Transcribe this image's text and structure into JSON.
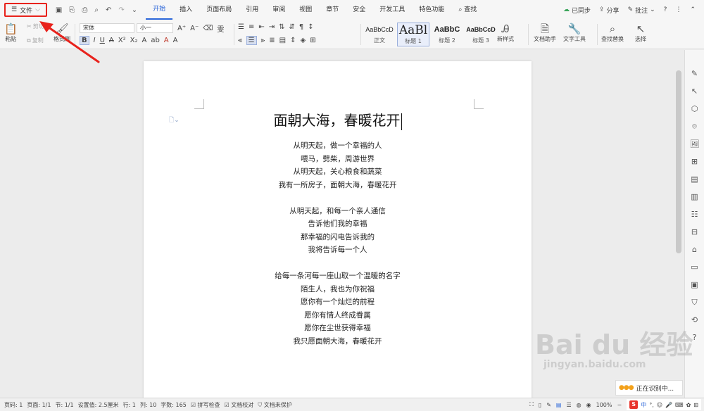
{
  "menubar": {
    "file_label": "文件",
    "tabs": [
      "开始",
      "插入",
      "页面布局",
      "引用",
      "审阅",
      "视图",
      "章节",
      "安全",
      "开发工具",
      "特色功能"
    ],
    "search_label": "查找",
    "sync_label": "已同步",
    "share_label": "分享",
    "comment_label": "批注",
    "help_label": "?"
  },
  "ribbon": {
    "paste_label": "粘贴",
    "cut_label": "剪切",
    "copy_label": "复制",
    "format_painter_label": "格式刷",
    "font_name": "宋体",
    "font_size": "小一",
    "styles": [
      {
        "sample": "AaBbCcD",
        "name": "正文"
      },
      {
        "sample": "AaBl",
        "name": "标题 1"
      },
      {
        "sample": "AaBbC",
        "name": "标题 2"
      },
      {
        "sample": "AaBbCcD",
        "name": "标题 3"
      }
    ],
    "new_style_label": "新样式",
    "doc_assistant_label": "文档助手",
    "text_tools_label": "文字工具",
    "find_replace_label": "查找替换",
    "select_label": "选择"
  },
  "document": {
    "title": "面朝大海，春暖花开",
    "stanzas": [
      [
        "从明天起，做一个幸福的人",
        "喂马，劈柴，周游世界",
        "从明天起，关心粮食和蔬菜",
        "我有一所房子，面朝大海，春暖花开"
      ],
      [
        "从明天起，和每一个亲人通信",
        "告诉他们我的幸福",
        "那幸福的闪电告诉我的",
        "我将告诉每一个人"
      ],
      [
        "给每一条河每一座山取一个温暖的名字",
        "陌生人，我也为你祝福",
        "愿你有一个灿烂的前程",
        "愿你有情人终成眷属",
        "愿你在尘世获得幸福",
        "我只愿面朝大海，春暖花开"
      ]
    ]
  },
  "statusbar": {
    "page_num": "页码: 1",
    "page": "页面: 1/1",
    "section": "节: 1/1",
    "setting": "设置值: 2.5厘米",
    "row": "行: 1",
    "col": "列: 10",
    "words": "字数: 165",
    "spell": "拼写检查",
    "proofread": "文档校对",
    "protect": "文档未保护",
    "zoom": "100%",
    "ime_label": "中"
  },
  "overlay": {
    "recognizing": "正在识别中...",
    "watermark_main": "Bai du 经验",
    "watermark_sub": "jingyan.baidu.com"
  },
  "colors": {
    "accent": "#2b66d9",
    "highlight_box": "#e8221c",
    "arrow": "#e8221c"
  }
}
